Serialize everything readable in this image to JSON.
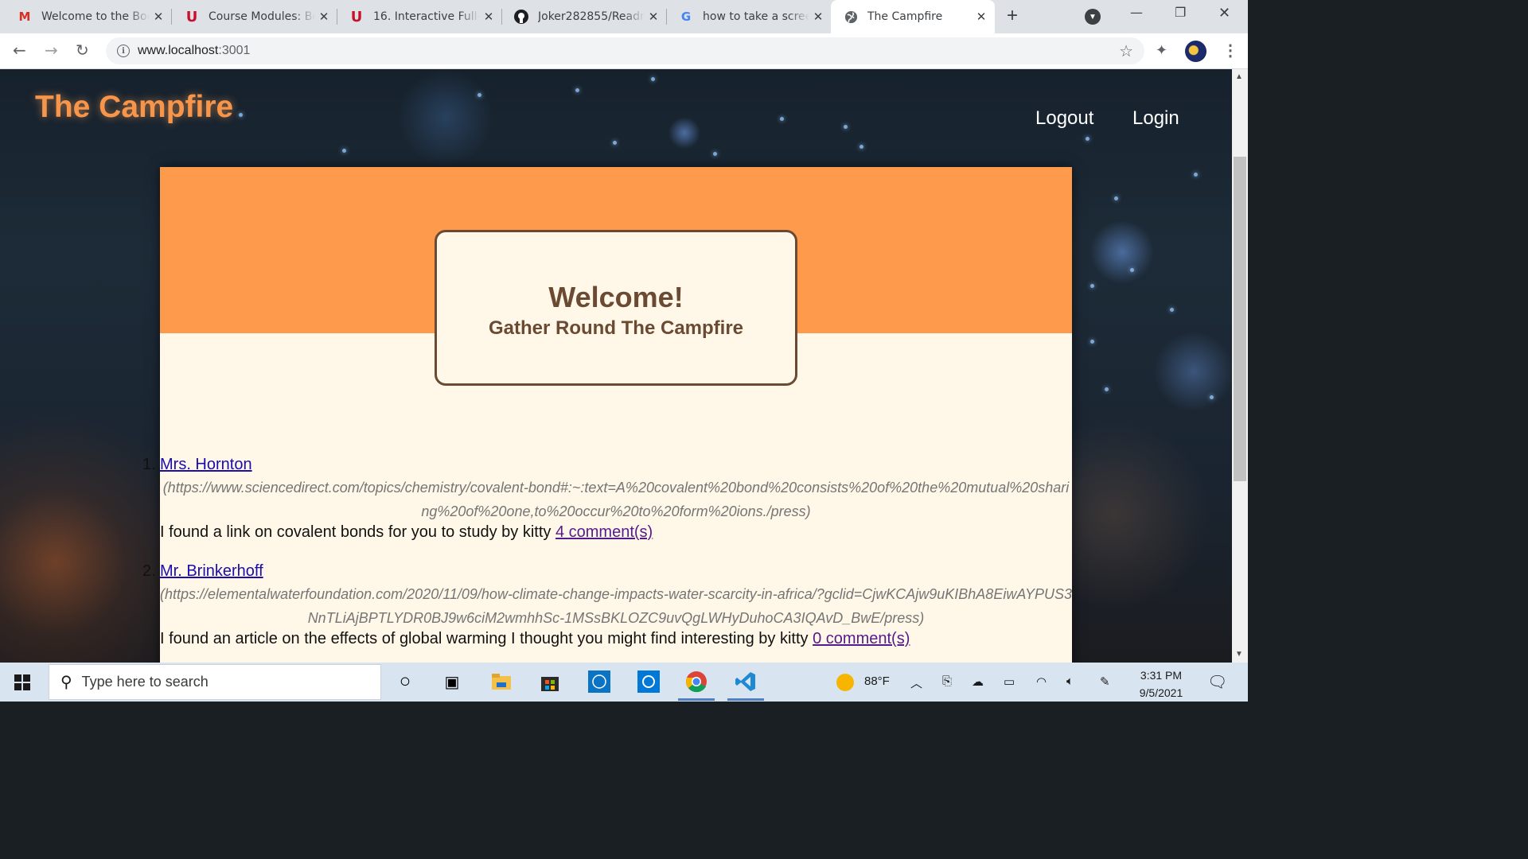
{
  "browser": {
    "tabs": [
      {
        "title": "Welcome to the Bootcamp",
        "icon": "gmail-icon"
      },
      {
        "title": "Course Modules: Bootcamp",
        "icon": "utah-u-icon"
      },
      {
        "title": "16. Interactive Full-Stack",
        "icon": "utah-u-icon"
      },
      {
        "title": "Joker282855/Readme",
        "icon": "github-icon"
      },
      {
        "title": "how to take a screenshot",
        "icon": "google-icon"
      },
      {
        "title": "The Campfire",
        "icon": "globe-icon"
      }
    ],
    "new_tab": "+",
    "address": {
      "host": "www.localhost",
      "port": ":3001"
    }
  },
  "site": {
    "brand": "The Campfire",
    "nav": {
      "logout": "Logout",
      "login": "Login"
    },
    "hero": {
      "title": "Welcome!",
      "subtitle": "Gather Round The Campfire"
    },
    "posts": [
      {
        "number": "1.",
        "author": "Mrs. Hornton",
        "link": "(https://www.sciencedirect.com/topics/chemistry/covalent-bond#:~:text=A%20covalent%20bond%20consists%20of%20the%20mutual%20sharing%20of%20one,to%20occur%20to%20form%20ions./press)",
        "text": "I found a link on covalent bonds for you to study by kitty ",
        "comments": "4 comment(s)"
      },
      {
        "number": "2.",
        "author": "Mr. Brinkerhoff",
        "link": "(https://elementalwaterfoundation.com/2020/11/09/how-climate-change-impacts-water-scarcity-in-africa/?gclid=CjwKCAjw9uKIBhA8EiwAYPUS3NnTLiAjBPTLYDR0BJ9w6ciM2wmhhSc-1MSsBKLOZC9uvQgLWHyDuhoCA3IQAvD_BwE/press)",
        "text": "I found an article on the effects of global warming I thought you might find interesting by kitty ",
        "comments": "0 comment(s)"
      }
    ]
  },
  "taskbar": {
    "search_placeholder": "Type here to search",
    "weather": "88°F",
    "time": "3:31 PM",
    "date": "9/5/2021"
  }
}
